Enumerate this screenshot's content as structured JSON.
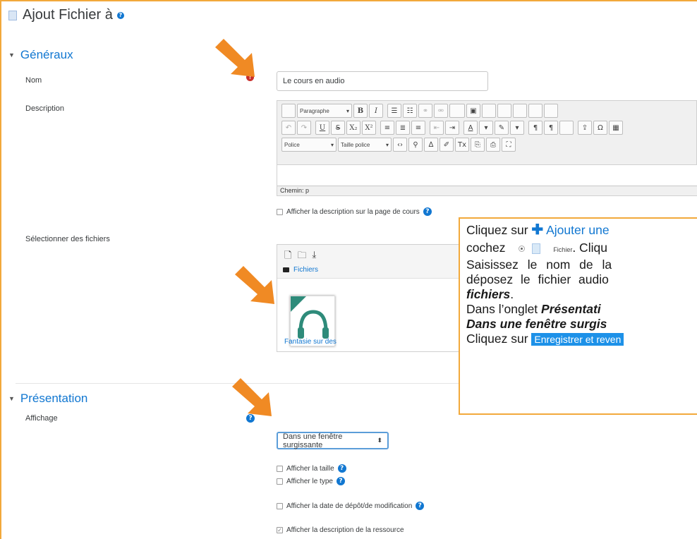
{
  "header": {
    "title": "Ajout Fichier à"
  },
  "general": {
    "section_title": "Généraux",
    "name_label": "Nom",
    "name_value": "Le cours en audio",
    "description_label": "Description",
    "editor": {
      "format_dropdown": "Paragraphe",
      "font_dropdown": "Police",
      "size_dropdown": "Taille police",
      "path_text": "Chemin: p"
    },
    "show_description_label": "Afficher la description sur la page de cours",
    "files_label": "Sélectionner des fichiers",
    "filemanager": {
      "path_label": "Fichiers",
      "file_name": "Fantasie sur des"
    }
  },
  "presentation": {
    "section_title": "Présentation",
    "display_label": "Affichage",
    "display_value": "Dans une fenêtre surgissante",
    "options": [
      {
        "label": "Afficher la taille",
        "checked": false,
        "help": true
      },
      {
        "label": "Afficher le type",
        "checked": false,
        "help": true
      },
      {
        "label": "Afficher la date de dépôt/de modification",
        "checked": false,
        "help": true
      },
      {
        "label": "Afficher la description de la ressource",
        "checked": true,
        "help": false
      }
    ]
  },
  "callout": {
    "l1_a": "Cliquez sur ",
    "l1_b": "Ajouter une",
    "l2_a": "cochez ",
    "l2_b": "Fichier",
    "l2_c": ". Cliqu",
    "l3": "Saisissez le nom de la",
    "l4": "déposez le fichier audio",
    "l5": "fichiers",
    "l5_end": ".",
    "l6_a": "Dans l’onglet ",
    "l6_b": "Présentati",
    "l7": "Dans une fenêtre surgis",
    "l8_a": "Cliquez sur ",
    "l8_b": "Enregistrer et reven"
  },
  "colors": {
    "accent": "#1177d1",
    "highlight": "#f2a93b",
    "required": "#c9302c"
  }
}
